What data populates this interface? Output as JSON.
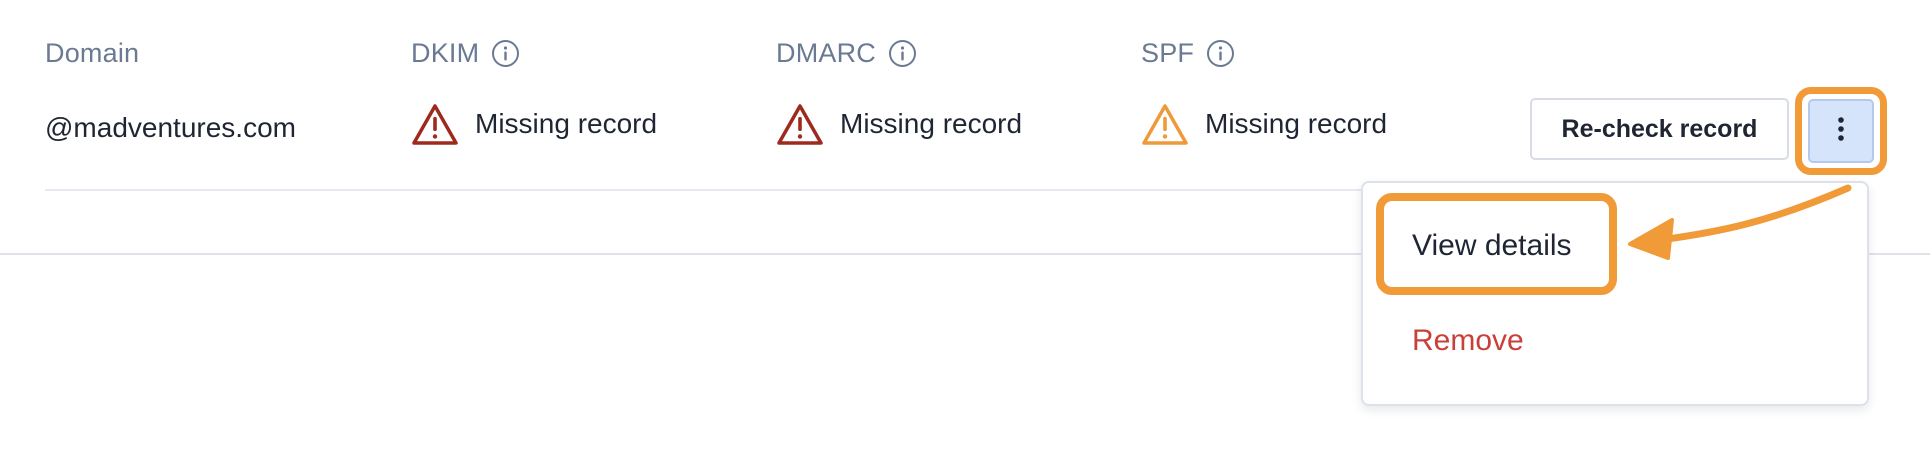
{
  "table": {
    "headers": {
      "domain": "Domain",
      "dkim": "DKIM",
      "dmarc": "DMARC",
      "spf": "SPF"
    },
    "row": {
      "domain": "@madventures.com",
      "dkim_status": "Missing record",
      "dmarc_status": "Missing record",
      "spf_status": "Missing record",
      "recheck_label": "Re-check record"
    }
  },
  "menu": {
    "items": [
      {
        "label": "View details"
      },
      {
        "label": "Remove"
      }
    ]
  },
  "colors": {
    "error": "#9e2a1e",
    "warning": "#ee9a3a",
    "highlight": "#f19a38",
    "remove": "#c9403a",
    "kebab_bg": "#d6e4fb"
  },
  "icons": {
    "info": "info-circle-icon",
    "error": "warning-triangle-icon",
    "warning": "warning-triangle-icon",
    "kebab": "kebab-menu-icon"
  }
}
